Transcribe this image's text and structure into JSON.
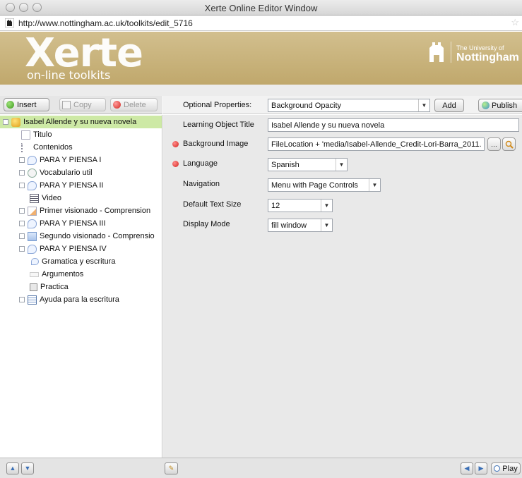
{
  "window": {
    "title": "Xerte Online Editor Window"
  },
  "browser": {
    "url": "http://www.nottingham.ac.uk/toolkits/edit_5716"
  },
  "banner": {
    "logo": "Xerte",
    "logo_sub": "on-line toolkits",
    "university_small": "The University of",
    "university_big": "Nottingham"
  },
  "toolbar": {
    "insert": "Insert",
    "copy": "Copy",
    "delete": "Delete"
  },
  "tree": {
    "items": [
      {
        "label": "Isabel Allende y su nueva novela"
      },
      {
        "label": "Titulo"
      },
      {
        "label": "Contenidos"
      },
      {
        "label": "PARA Y PIENSA I"
      },
      {
        "label": "Vocabulario util"
      },
      {
        "label": "PARA Y PIENSA II"
      },
      {
        "label": "Video"
      },
      {
        "label": "Primer visionado - Comprension"
      },
      {
        "label": "PARA Y PIENSA III"
      },
      {
        "label": "Segundo visionado - Comprensio"
      },
      {
        "label": "PARA Y PIENSA IV"
      },
      {
        "label": "Gramatica y escritura"
      },
      {
        "label": "Argumentos"
      },
      {
        "label": "Practica"
      },
      {
        "label": "Ayuda para la escritura"
      }
    ]
  },
  "properties": {
    "optional_label": "Optional Properties:",
    "optional_value": "Background Opacity",
    "add": "Add",
    "publish": "Publish",
    "rows": [
      {
        "label": "Learning Object Title",
        "value": "Isabel Allende y su nueva novela"
      },
      {
        "label": "Background Image",
        "value": "FileLocation + 'media/Isabel-Allende_Credit-Lori-Barra_2011."
      },
      {
        "label": "Language",
        "value": "Spanish"
      },
      {
        "label": "Navigation",
        "value": "Menu with Page Controls"
      },
      {
        "label": "Default Text Size",
        "value": "12"
      },
      {
        "label": "Display Mode",
        "value": "fill window"
      }
    ]
  },
  "bottom": {
    "play": "Play"
  },
  "colors": {
    "selected_bg": "#cde9a5",
    "banner": "#c8b07a",
    "required": "#d2261f"
  }
}
